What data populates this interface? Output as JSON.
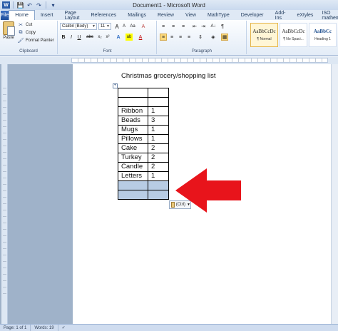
{
  "window": {
    "title": "Document1 - Microsoft Word"
  },
  "qat": {
    "save_icon": "save-icon",
    "undo_icon": "undo-icon",
    "redo_icon": "redo-icon"
  },
  "tabs": [
    {
      "label": "File"
    },
    {
      "label": "Home"
    },
    {
      "label": "Insert"
    },
    {
      "label": "Page Layout"
    },
    {
      "label": "References"
    },
    {
      "label": "Mailings"
    },
    {
      "label": "Review"
    },
    {
      "label": "View"
    },
    {
      "label": "MathType"
    },
    {
      "label": "Developer"
    },
    {
      "label": "Add-Ins"
    },
    {
      "label": "eXtyles"
    },
    {
      "label": "ISO mathematics"
    }
  ],
  "ribbon": {
    "clipboard": {
      "paste_label": "Paste",
      "cut_label": "Cut",
      "copy_label": "Copy",
      "format_painter_label": "Format Painter",
      "group_label": "Clipboard"
    },
    "font": {
      "font_name": "Calibri (Body)",
      "font_size": "11",
      "group_label": "Font",
      "bold": "B",
      "italic": "I",
      "underline": "U",
      "strike": "abc",
      "subscript": "x₂",
      "superscript": "x²",
      "grow": "A",
      "shrink": "A",
      "case": "Aa",
      "clear": "A",
      "highlight": "ab",
      "font_color": "A"
    },
    "paragraph": {
      "group_label": "Paragraph"
    },
    "styles": [
      {
        "sample": "AaBbCcDc",
        "name": "¶ Normal"
      },
      {
        "sample": "AaBbCcDc",
        "name": "¶ No Spaci..."
      },
      {
        "sample": "AaBbCc",
        "name": "Heading 1"
      }
    ]
  },
  "document": {
    "heading": "Christmas grocery/shopping list",
    "rows": [
      {
        "item": "",
        "qty": ""
      },
      {
        "item": "",
        "qty": ""
      },
      {
        "item": "Ribbon",
        "qty": "1"
      },
      {
        "item": "Beads",
        "qty": "3"
      },
      {
        "item": "Mugs",
        "qty": "1"
      },
      {
        "item": "Pillows",
        "qty": "1"
      },
      {
        "item": "Cake",
        "qty": "2"
      },
      {
        "item": "Turkey",
        "qty": "2"
      },
      {
        "item": "Candle",
        "qty": "2"
      },
      {
        "item": "Letters",
        "qty": "1"
      },
      {
        "item": "",
        "qty": "",
        "selected": true
      },
      {
        "item": "",
        "qty": "",
        "selected": true
      }
    ],
    "paste_options_label": "(Ctrl)"
  },
  "status": {
    "page": "Page: 1 of 1",
    "words": "Words: 19"
  },
  "colors": {
    "arrow": "#e8141b",
    "selection": "#b8cce4",
    "file_tab": "#2a5ca8"
  }
}
